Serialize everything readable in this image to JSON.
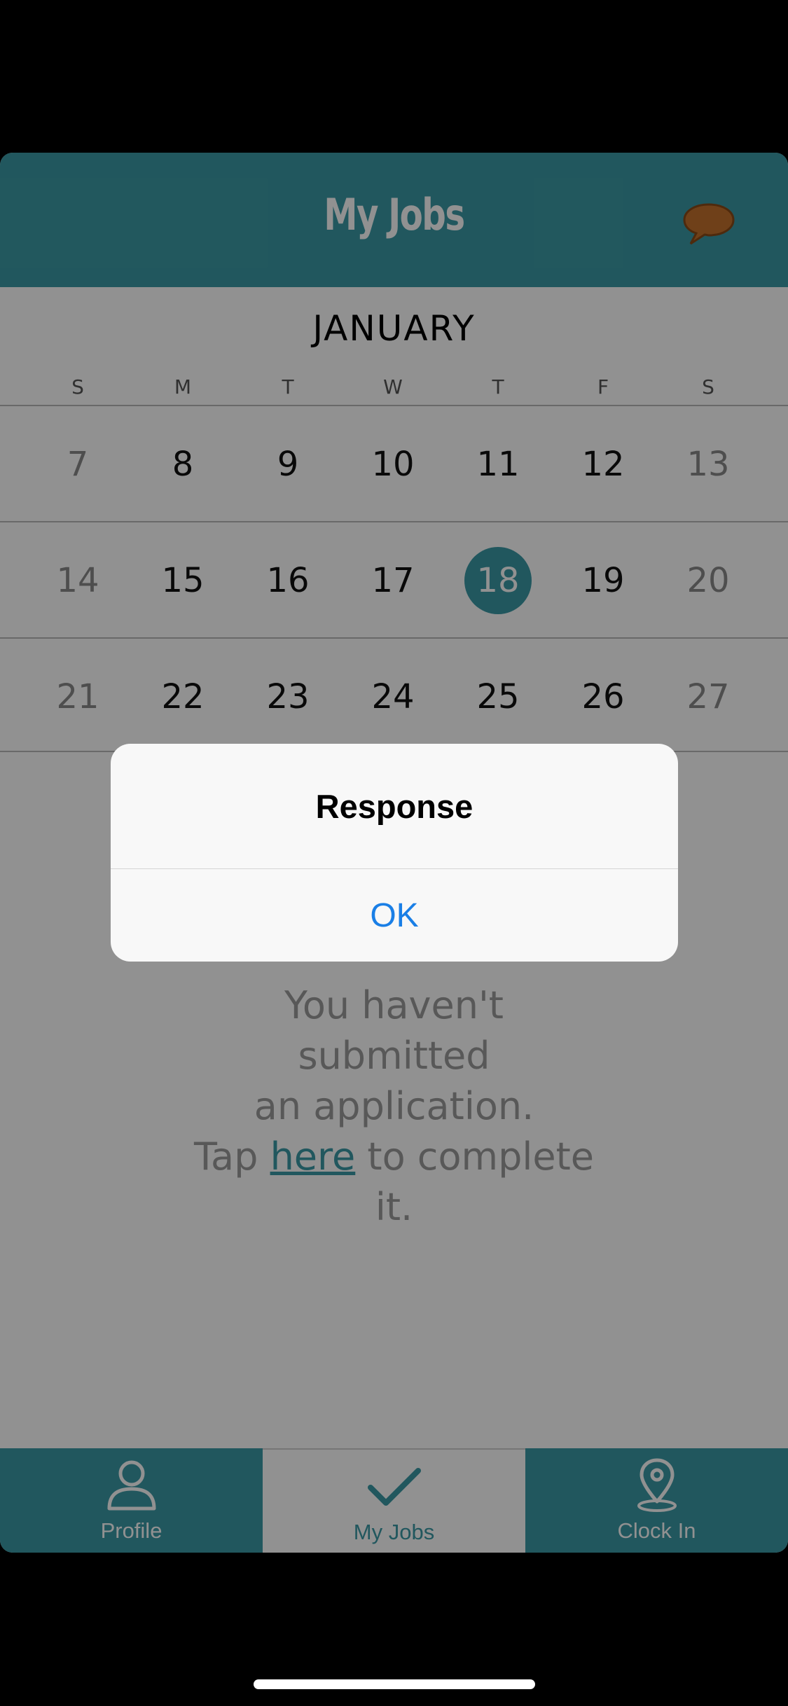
{
  "header": {
    "title": "My Jobs",
    "chat_icon": "speech-bubble-icon",
    "chat_color": "#c4712c"
  },
  "calendar": {
    "month": "JANUARY",
    "weekdays": [
      "S",
      "M",
      "T",
      "W",
      "T",
      "F",
      "S"
    ],
    "weeks": [
      [
        "7",
        "8",
        "9",
        "10",
        "11",
        "12",
        "13"
      ],
      [
        "14",
        "15",
        "16",
        "17",
        "18",
        "19",
        "20"
      ],
      [
        "21",
        "22",
        "23",
        "24",
        "25",
        "26",
        "27"
      ]
    ],
    "selected_day": "18"
  },
  "message": {
    "line1": "You haven't",
    "line2": "submitted",
    "line3": "an application.",
    "tap": "Tap",
    "link": "here",
    "rest": "to complete",
    "end": "it."
  },
  "tabbar": {
    "tabs": [
      {
        "label": "Profile",
        "icon": "person-icon"
      },
      {
        "label": "My Jobs",
        "icon": "checkmark-icon",
        "active": true
      },
      {
        "label": "Clock In",
        "icon": "location-pin-icon"
      }
    ]
  },
  "alert": {
    "title": "Response",
    "ok_label": "OK"
  },
  "colors": {
    "accent": "#3b9aa6",
    "link": "#1a7fe6"
  }
}
